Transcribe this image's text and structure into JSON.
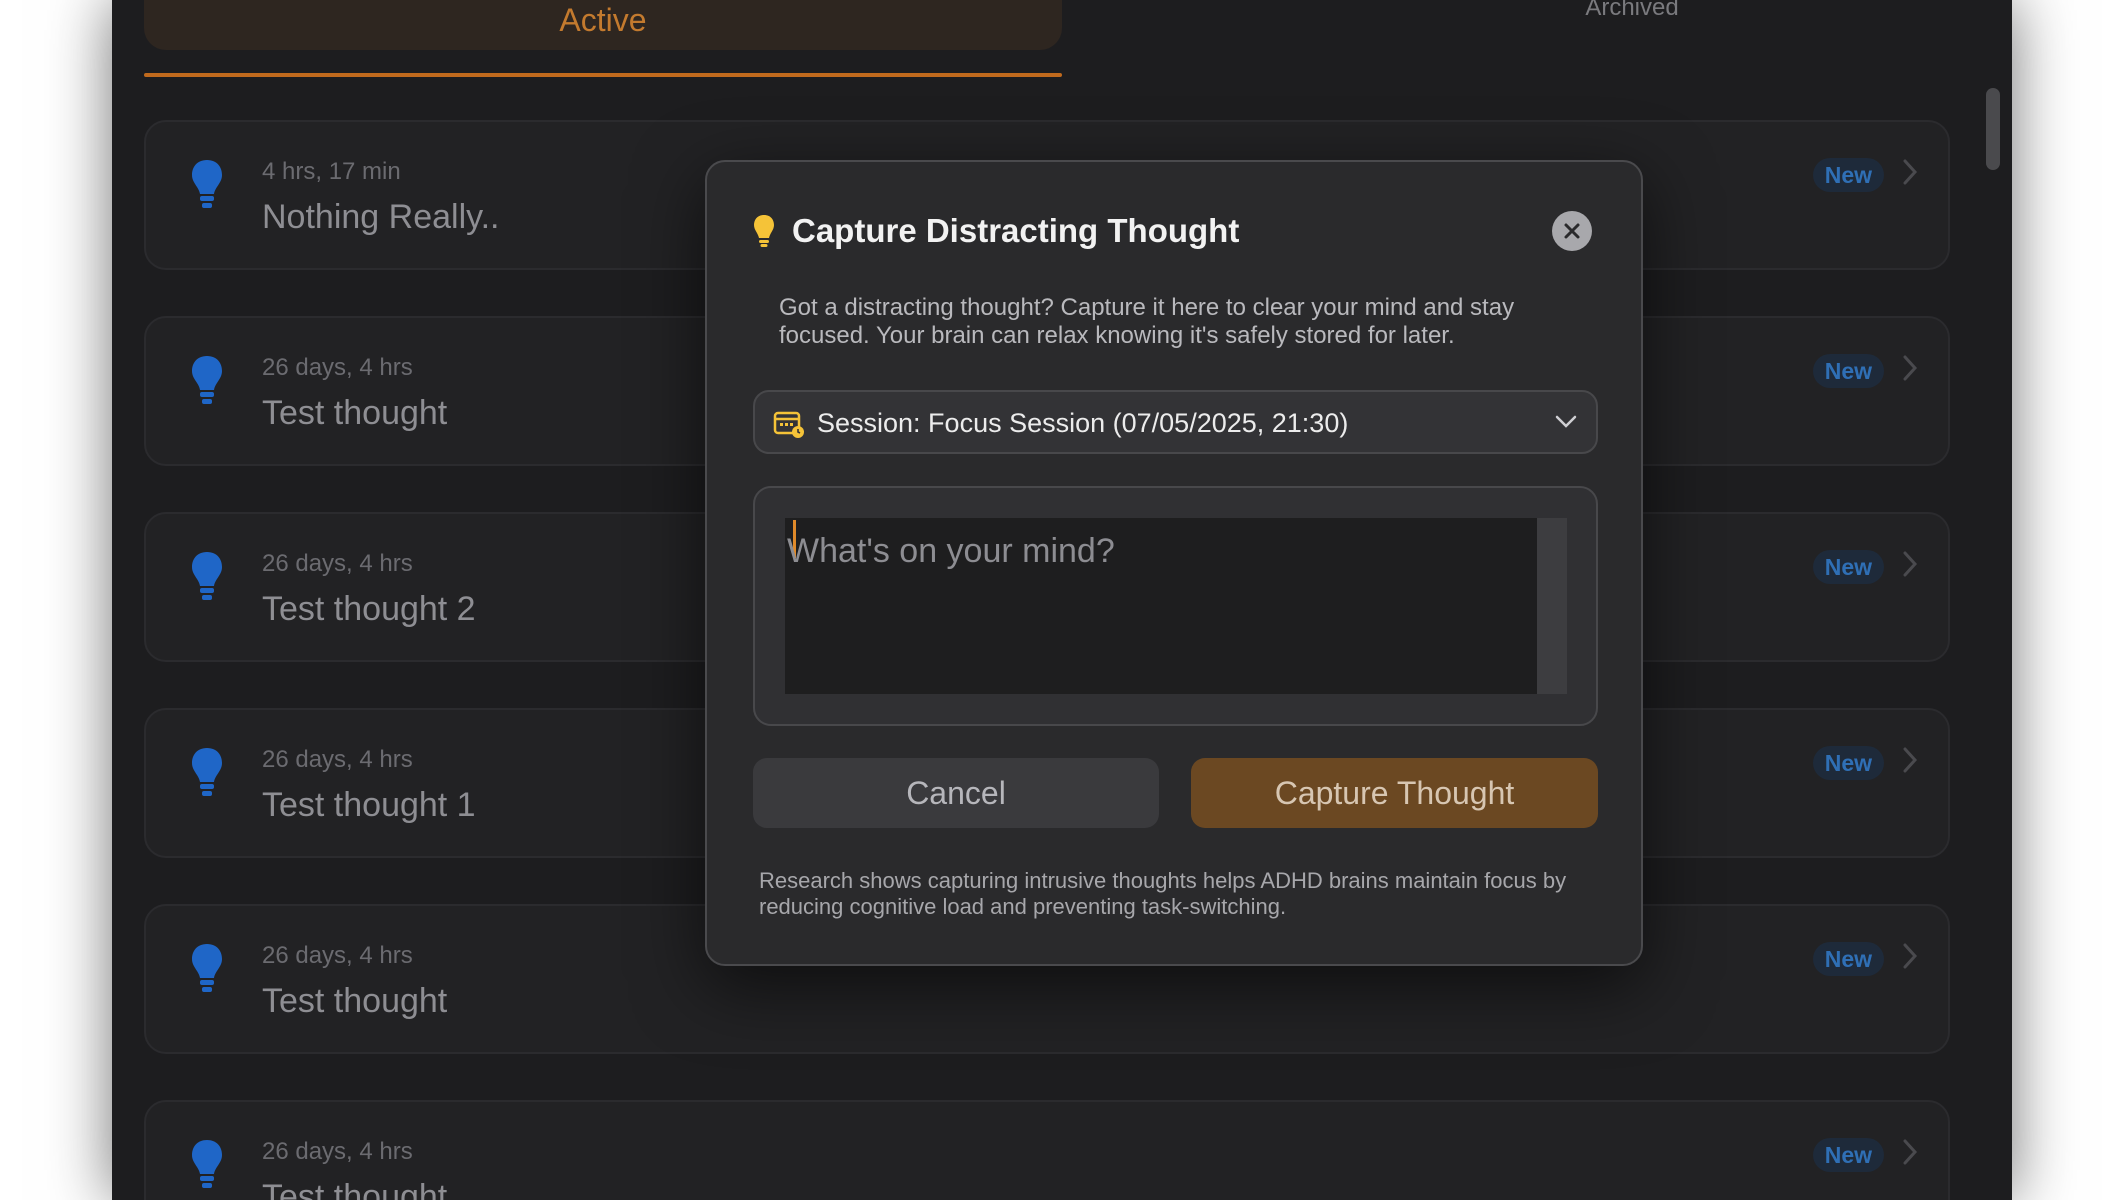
{
  "tabs": {
    "active_label": "Active",
    "archived_label": "Archived"
  },
  "thoughts": [
    {
      "time": "4 hrs, 17 min",
      "title": "Nothing Really..",
      "badge": "New"
    },
    {
      "time": "26 days, 4 hrs",
      "title": "Test thought",
      "badge": "New"
    },
    {
      "time": "26 days, 4 hrs",
      "title": "Test thought 2",
      "badge": "New"
    },
    {
      "time": "26 days, 4 hrs",
      "title": "Test thought 1",
      "badge": "New"
    },
    {
      "time": "26 days, 4 hrs",
      "title": "Test thought",
      "badge": "New"
    },
    {
      "time": "26 days, 4 hrs",
      "title": "Test thought",
      "badge": "New"
    }
  ],
  "modal": {
    "title": "Capture Distracting Thought",
    "description": "Got a distracting thought? Capture it here to clear your mind and stay focused. Your brain can relax knowing it's safely stored for later.",
    "session_selected": "Session: Focus Session (07/05/2025, 21:30)",
    "input_placeholder": "What's on your mind?",
    "cancel_label": "Cancel",
    "capture_label": "Capture Thought",
    "footnote": "Research shows capturing intrusive thoughts helps ADHD brains maintain focus by reducing cognitive load and preventing task-switching."
  },
  "icons": {
    "list_item": "lightbulb-icon",
    "modal_title": "lightbulb-icon",
    "close": "close-icon",
    "session": "calendar-clock-icon",
    "dropdown": "chevron-down-icon",
    "row_chevron": "chevron-right-icon"
  },
  "colors": {
    "accent": "#c06a1d",
    "bulb_blue": "#1f66c7",
    "bulb_yellow": "#f5c338",
    "badge_text": "#2f6fb5"
  }
}
